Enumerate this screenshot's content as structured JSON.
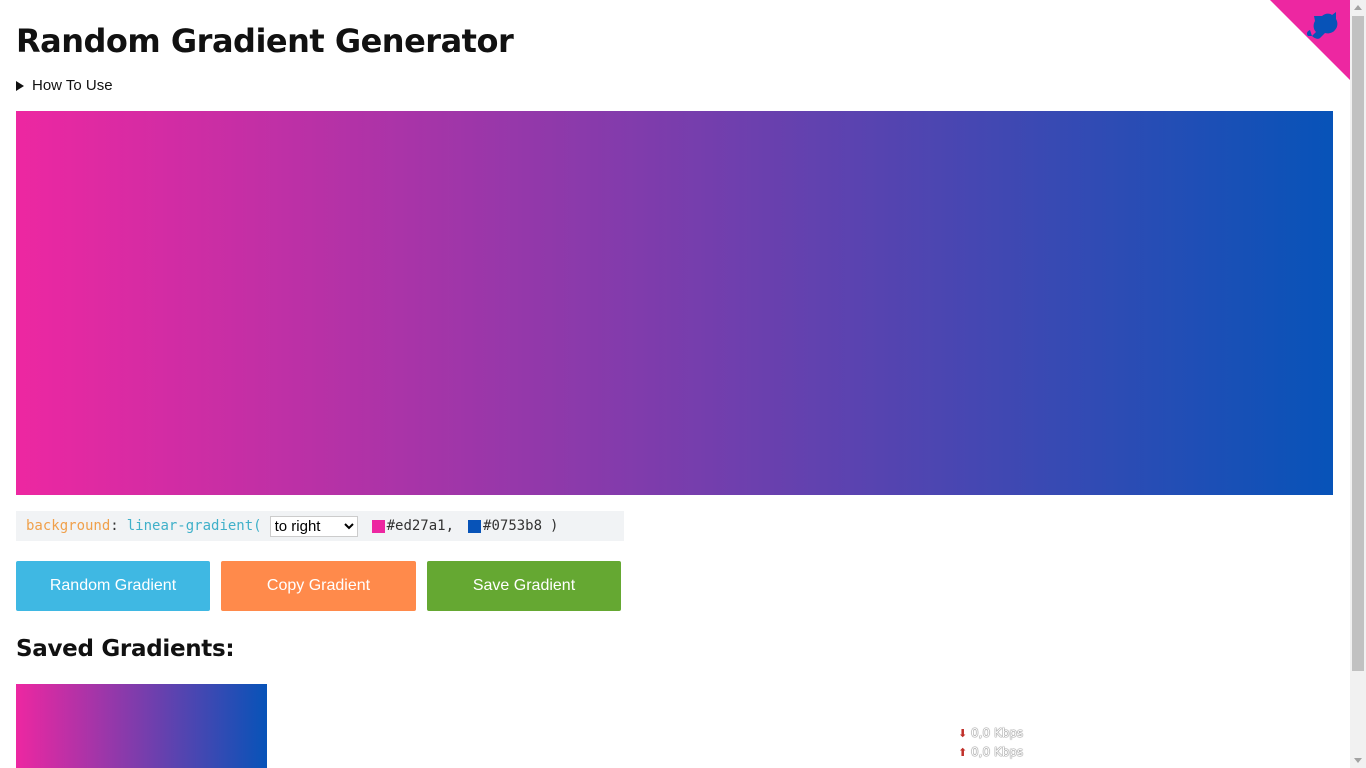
{
  "header": {
    "title": "Random Gradient Generator",
    "how_to_label": "How To Use"
  },
  "gradient": {
    "direction": "to right",
    "direction_options": [
      "to right"
    ],
    "color_start": "#ed27a1",
    "color_end": "#0753b8"
  },
  "code": {
    "property": "background",
    "colon": ":",
    "function": "linear-gradient(",
    "color_start_text": "#ed27a1,",
    "color_end_text": "#0753b8",
    "close_paren": ")"
  },
  "buttons": {
    "random_label": "Random Gradient",
    "random_color": "#3fb8e3",
    "copy_label": "Copy Gradient",
    "copy_color": "#ff8a4b",
    "save_label": "Save Gradient",
    "save_color": "#65a832"
  },
  "saved": {
    "heading": "Saved Gradients:"
  },
  "network": {
    "down_icon": "down-arrow-icon",
    "down_text": "0,0 Kbps",
    "up_icon": "up-arrow-icon",
    "up_text": "0,0 Kbps"
  },
  "corner": {
    "icon": "github-octocat-icon",
    "bg_color": "#ed27a1",
    "icon_color": "#0753b8"
  }
}
